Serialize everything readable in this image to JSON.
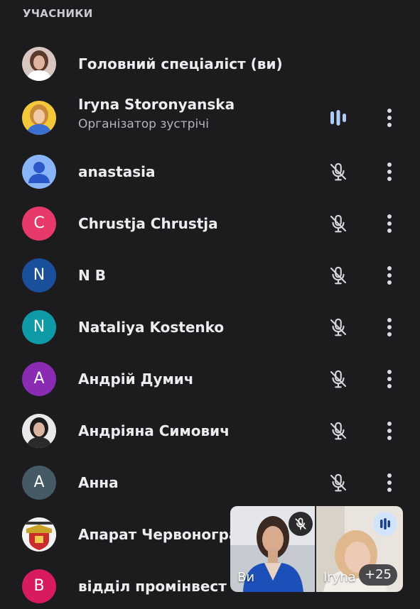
{
  "section": {
    "title": "УЧАСНИКИ"
  },
  "participants": [
    {
      "name": "Головний спеціаліст (ви)",
      "subtitle": "",
      "avatar": {
        "kind": "photo",
        "icon": "user-photo"
      },
      "mic": "none"
    },
    {
      "name": "Iryna Storonyanska",
      "subtitle": "Організатор зустрічі",
      "avatar": {
        "kind": "photo",
        "icon": "user-photo"
      },
      "mic": "speaking"
    },
    {
      "name": "anastasia",
      "subtitle": "",
      "avatar": {
        "kind": "default-person",
        "icon": "person-icon",
        "color": "#8ab4f8"
      },
      "mic": "muted"
    },
    {
      "name": "Chrustja Chrustja",
      "subtitle": "",
      "avatar": {
        "kind": "letter",
        "letter": "C",
        "color": "#e8396b"
      },
      "mic": "muted"
    },
    {
      "name": "N B",
      "subtitle": "",
      "avatar": {
        "kind": "letter",
        "letter": "N",
        "color": "#1a4f9c"
      },
      "mic": "muted"
    },
    {
      "name": "Nataliya Kostenko",
      "subtitle": "",
      "avatar": {
        "kind": "letter",
        "letter": "N",
        "color": "#0f9aa8"
      },
      "mic": "muted"
    },
    {
      "name": "Андрій Думич",
      "subtitle": "",
      "avatar": {
        "kind": "letter",
        "letter": "A",
        "color": "#8b2bb3"
      },
      "mic": "muted"
    },
    {
      "name": "Андріяна Симович",
      "subtitle": "",
      "avatar": {
        "kind": "photo",
        "icon": "user-photo"
      },
      "mic": "muted"
    },
    {
      "name": "Анна",
      "subtitle": "",
      "avatar": {
        "kind": "letter",
        "letter": "A",
        "color": "#455a64"
      },
      "mic": "muted"
    },
    {
      "name": "Апарат Червоногра",
      "subtitle": "",
      "avatar": {
        "kind": "emblem",
        "icon": "coat-of-arms"
      },
      "mic": "hidden"
    },
    {
      "name": "відділ промінвест",
      "subtitle": "",
      "avatar": {
        "kind": "letter",
        "letter": "B",
        "color": "#d81b60"
      },
      "mic": "hidden"
    }
  ],
  "pip": {
    "self_label": "Ви",
    "other_label": "Iryna",
    "more_count": "+25",
    "self_icon": "mic-off-icon",
    "other_icon": "audio-level-icon"
  },
  "colors": {
    "background": "#1c1c1f",
    "speaking_accent": "#aecbfa",
    "muted_icon": "#d5d7db"
  }
}
